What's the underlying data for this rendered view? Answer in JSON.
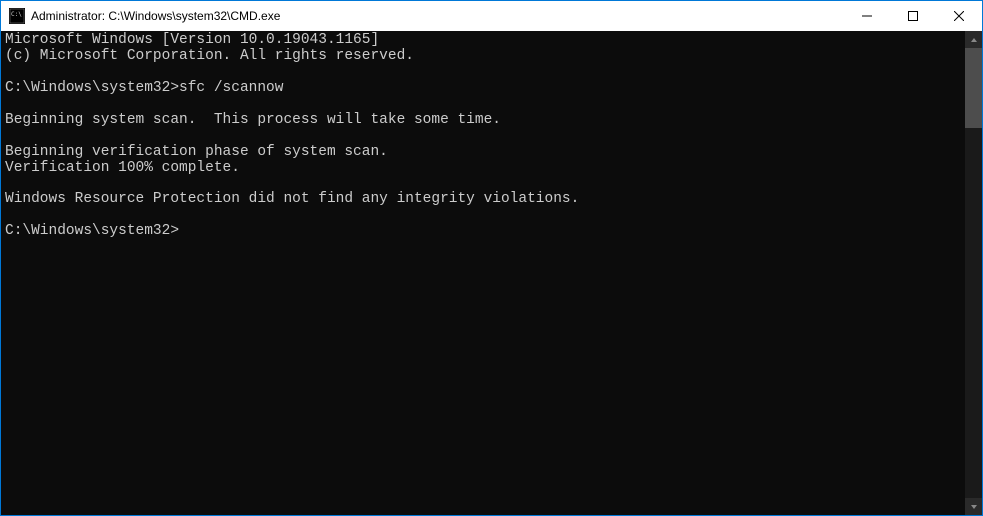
{
  "titlebar": {
    "title": "Administrator: C:\\Windows\\system32\\CMD.exe"
  },
  "terminal": {
    "line1": "Microsoft Windows [Version 10.0.19043.1165]",
    "line2": "(c) Microsoft Corporation. All rights reserved.",
    "blank1": "",
    "prompt1_path": "C:\\Windows\\system32>",
    "prompt1_command": "sfc /scannow",
    "blank2": "",
    "line3": "Beginning system scan.  This process will take some time.",
    "blank3": "",
    "line4": "Beginning verification phase of system scan.",
    "line5": "Verification 100% complete.",
    "blank4": "",
    "line6": "Windows Resource Protection did not find any integrity violations.",
    "blank5": "",
    "prompt2_path": "C:\\Windows\\system32>"
  }
}
